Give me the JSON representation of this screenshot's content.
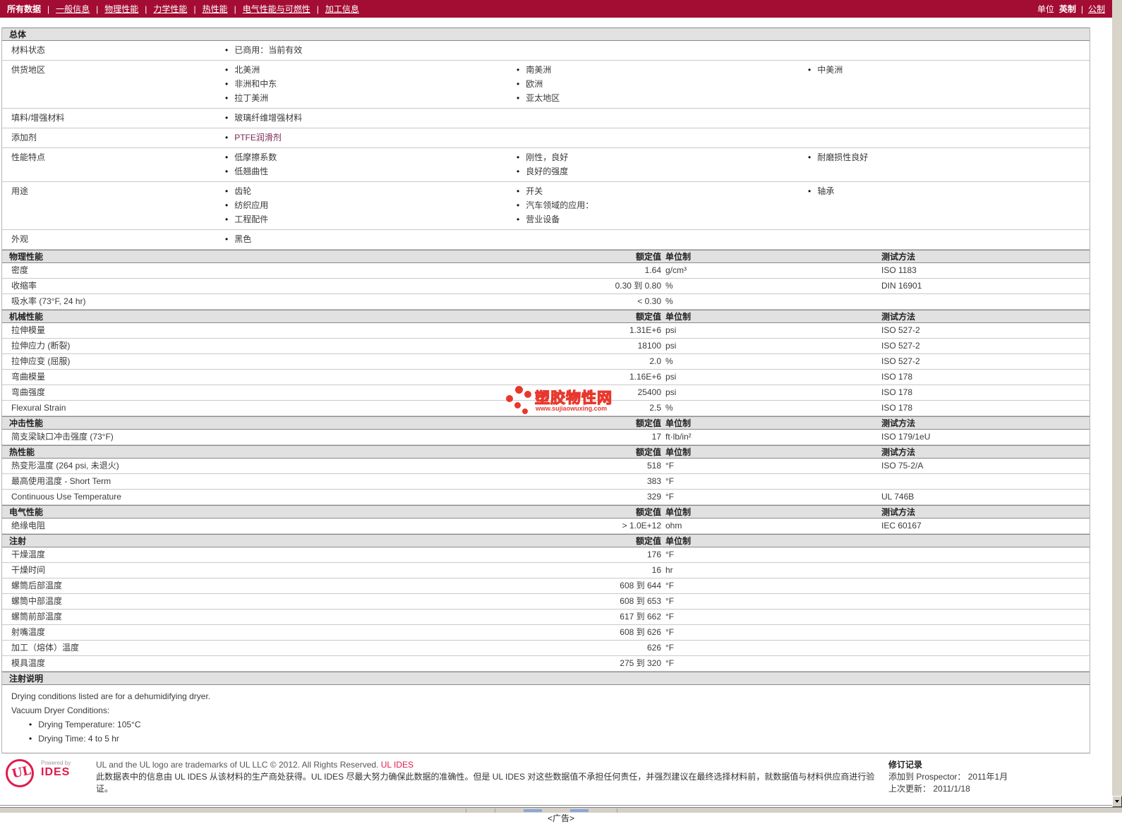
{
  "colors": {
    "nav_red": "#a30c33",
    "brand_pink": "#e01b4c",
    "watermark_red": "#e8382d",
    "additive_link": "#7c2653"
  },
  "nav": {
    "items": [
      {
        "label": "所有数据",
        "active": true
      },
      {
        "label": "一般信息",
        "active": false
      },
      {
        "label": "物理性能",
        "active": false
      },
      {
        "label": "力学性能",
        "active": false
      },
      {
        "label": "热性能",
        "active": false
      },
      {
        "label": "电气性能与可燃性",
        "active": false
      },
      {
        "label": "加工信息",
        "active": false
      }
    ],
    "units_label": "单位",
    "unit_active": "英制",
    "unit_alt": "公制"
  },
  "labels": {
    "rating": "额定值",
    "unit_system": "单位制",
    "test_method": "测试方法"
  },
  "general": {
    "title": "总体",
    "rows": [
      {
        "label": "材料状态",
        "cols": [
          [
            "已商用：当前有效"
          ],
          [],
          []
        ]
      },
      {
        "label": "供货地区",
        "cols": [
          [
            "北美洲",
            "非洲和中东",
            "拉丁美洲"
          ],
          [
            "南美洲",
            "欧洲",
            "亚太地区"
          ],
          [
            "中美洲"
          ]
        ]
      },
      {
        "label": "填料/增强材料",
        "cols": [
          [
            "玻璃纤维增强材料"
          ],
          [],
          []
        ]
      },
      {
        "label": "添加剂",
        "accent": true,
        "cols": [
          [
            "PTFE润滑剂"
          ],
          [],
          []
        ]
      },
      {
        "label": "性能特点",
        "cols": [
          [
            "低摩擦系数",
            "低翘曲性"
          ],
          [
            "刚性，良好",
            "良好的强度"
          ],
          [
            "耐磨损性良好"
          ]
        ]
      },
      {
        "label": "用途",
        "cols": [
          [
            "齿轮",
            "纺织应用",
            "工程配件"
          ],
          [
            "开关",
            "汽车领域的应用：",
            "营业设备"
          ],
          [
            "轴承"
          ]
        ]
      },
      {
        "label": "外观",
        "cols": [
          [
            "黑色"
          ],
          [],
          []
        ]
      }
    ]
  },
  "sections": [
    {
      "title": "物理性能",
      "has_method": true,
      "rows": [
        {
          "name": "密度",
          "value": "1.64",
          "unit": "g/cm³",
          "method": "ISO 1183"
        },
        {
          "name": "收缩率",
          "value": "0.30 到  0.80",
          "unit": "%",
          "method": "DIN 16901"
        },
        {
          "name": "吸水率  (73°F, 24 hr)",
          "value": "< 0.30",
          "unit": "%",
          "method": ""
        }
      ]
    },
    {
      "title": "机械性能",
      "has_method": true,
      "rows": [
        {
          "name": "拉伸模量",
          "value": "1.31E+6",
          "unit": "psi",
          "method": "ISO 527-2"
        },
        {
          "name": "拉伸应力  (断裂)",
          "value": "18100",
          "unit": "psi",
          "method": "ISO 527-2"
        },
        {
          "name": "拉伸应变  (屈服)",
          "value": "2.0",
          "unit": "%",
          "method": "ISO 527-2"
        },
        {
          "name": "弯曲模量",
          "value": "1.16E+6",
          "unit": "psi",
          "method": "ISO 178"
        },
        {
          "name": "弯曲强度",
          "value": "25400",
          "unit": "psi",
          "method": "ISO 178"
        },
        {
          "name": "Flexural Strain",
          "value": "2.5",
          "unit": "%",
          "method": "ISO 178"
        }
      ]
    },
    {
      "title": "冲击性能",
      "has_method": true,
      "rows": [
        {
          "name": "简支梁缺口冲击强度  (73°F)",
          "value": "17",
          "unit": "ft·lb/in²",
          "method": "ISO 179/1eU"
        }
      ]
    },
    {
      "title": "热性能",
      "has_method": true,
      "rows": [
        {
          "name": "热变形温度  (264 psi, 未退火)",
          "value": "518",
          "unit": "°F",
          "method": "ISO 75-2/A"
        },
        {
          "name": "最高使用温度  - Short Term",
          "value": "383",
          "unit": "°F",
          "method": ""
        },
        {
          "name": "Continuous Use Temperature",
          "value": "329",
          "unit": "°F",
          "method": "UL 746B"
        }
      ]
    },
    {
      "title": "电气性能",
      "has_method": true,
      "rows": [
        {
          "name": "绝缘电阻",
          "value": "> 1.0E+12",
          "unit": "ohm",
          "method": "IEC 60167"
        }
      ]
    },
    {
      "title": "注射",
      "has_method": false,
      "rows": [
        {
          "name": "干燥温度",
          "value": "176",
          "unit": "°F",
          "method": ""
        },
        {
          "name": "干燥时间",
          "value": "16",
          "unit": "hr",
          "method": ""
        },
        {
          "name": "螺筒后部温度",
          "value": "608 到  644",
          "unit": "°F",
          "method": ""
        },
        {
          "name": "螺筒中部温度",
          "value": "608 到  653",
          "unit": "°F",
          "method": ""
        },
        {
          "name": "螺筒前部温度",
          "value": "617 到  662",
          "unit": "°F",
          "method": ""
        },
        {
          "name": "射嘴温度",
          "value": "608 到  626",
          "unit": "°F",
          "method": ""
        },
        {
          "name": "加工（熔体）温度",
          "value": "626",
          "unit": "°F",
          "method": ""
        },
        {
          "name": "模具温度",
          "value": "275 到  320",
          "unit": "°F",
          "method": ""
        }
      ]
    }
  ],
  "notes": {
    "title": "注射说明",
    "paragraphs": [
      "Drying conditions listed are for a dehumidifying dryer.",
      "Vacuum Dryer Conditions:"
    ],
    "bullets": [
      "Drying Temperature: 105°C",
      "Drying Time: 4 to 5 hr"
    ]
  },
  "watermark": {
    "text": "塑胶物性网",
    "url": "www.sujiaowuxing.com"
  },
  "footer": {
    "ul_mark": "UL",
    "powered_by": "Powered by",
    "brand": "IDES",
    "line1": "UL and the UL logo are trademarks of UL LLC © 2012. All Rights Reserved. ",
    "line1_link": "UL IDES",
    "line2": "此数据表中的信息由  UL IDES 从该材料的生产商处获得。UL IDES 尽最大努力确保此数据的准确性。但是  UL IDES 对这些数据值不承担任何责任，并强烈建议在最终选择材料前，就数据值与材料供应商进行验证。",
    "revision": {
      "title": "修订记录",
      "added_label": "添加到  Prospector：",
      "added_value": "2011年1月",
      "updated_label": "上次更新：",
      "updated_value": "2011/1/18"
    }
  },
  "ad_text": "<广告>"
}
